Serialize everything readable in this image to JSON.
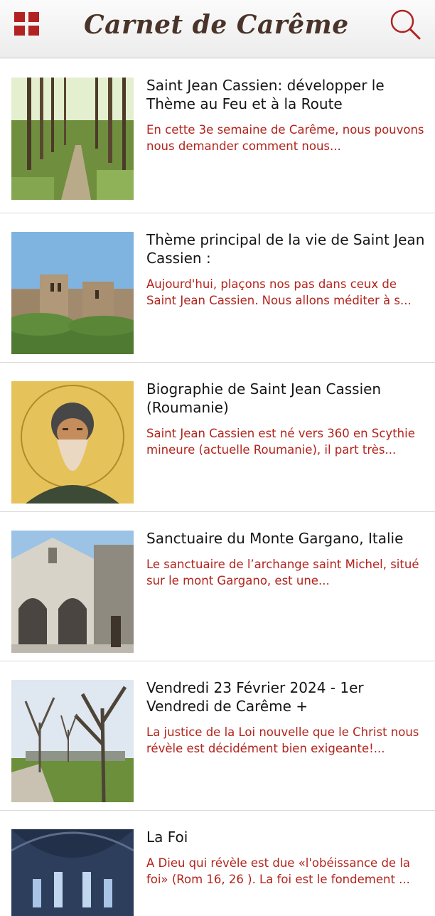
{
  "header": {
    "title": "Carnet de Carême",
    "menu_icon": "grid-menu-icon",
    "search_icon": "search-icon",
    "accent_color": "#b22222",
    "title_color": "#4a342a"
  },
  "articles": [
    {
      "title": "Saint Jean Cassien: développer le Thème au Feu et à la Route",
      "excerpt": "En cette 3e semaine de Carême, nous pouvons nous demander comment nous...",
      "image": "forest-path-image"
    },
    {
      "title": "Thème principal de la vie de Saint Jean Cassien :",
      "excerpt": "Aujourd'hui, plaçons nos pas dans ceux de Saint Jean Cassien. Nous allons méditer à s...",
      "image": "abbey-towers-image"
    },
    {
      "title": "Biographie de Saint Jean Cassien (Roumanie)",
      "excerpt": "Saint Jean Cassien est né vers 360 en Scythie mineure (actuelle Roumanie), il part très...",
      "image": "saint-icon-image"
    },
    {
      "title": "Sanctuaire du Monte Gargano, Italie",
      "excerpt": "Le sanctuaire de l’archange saint Michel, situé sur le mont Gargano, est une...",
      "image": "sanctuary-facade-image"
    },
    {
      "title": "Vendredi 23 Février 2024 - 1er Vendredi de Carême +",
      "excerpt": "La justice de la Loi nouvelle que le Christ nous révèle est décidément bien exigeante!...",
      "image": "bare-trees-avenue-image"
    },
    {
      "title": "La Foi",
      "excerpt": "A Dieu qui révèle est due «l'obéissance de la foi» (Rom 16, 26 ). La foi est le fondement ...",
      "image": "cathedral-interior-image"
    }
  ]
}
